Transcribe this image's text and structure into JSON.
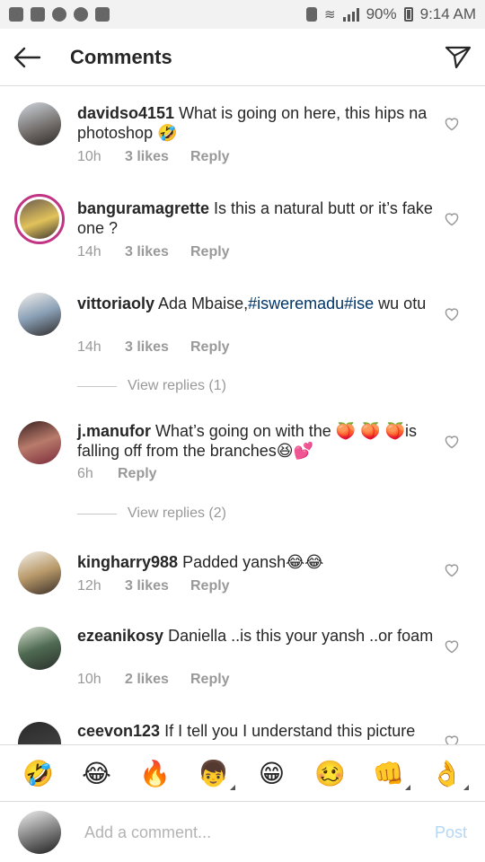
{
  "status_bar": {
    "battery": "90%",
    "time": "9:14 AM"
  },
  "header": {
    "title": "Comments"
  },
  "comments": [
    {
      "username": "davidso4151",
      "text": " What is going on here, this hips na photoshop 🤣",
      "time": "10h",
      "likes": "3 likes",
      "reply": "Reply"
    },
    {
      "username": "banguramagrette",
      "text": " Is this a natural butt or it’s fake one ?",
      "time": "14h",
      "likes": "3 likes",
      "reply": "Reply"
    },
    {
      "username": "vittoriaoly",
      "text_before": " Ada Mbaise,",
      "hashtag": "#isweremadu#ise",
      "text_after": " wu otu",
      "time": "14h",
      "likes": "3 likes",
      "reply": "Reply",
      "view_replies": "View replies (1)"
    },
    {
      "username": "j.manufor",
      "text": " What’s going on with the 🍑 🍑 🍑is falling off from the branches😆💕",
      "time": "6h",
      "reply": "Reply",
      "view_replies": "View replies (2)"
    },
    {
      "username": "kingharry988",
      "text": " Padded yansh😂😂",
      "time": "12h",
      "likes": "3 likes",
      "reply": "Reply"
    },
    {
      "username": "ezeanikosy",
      "text": " Daniella ..is this your yansh ..or foam",
      "time": "10h",
      "likes": "2 likes",
      "reply": "Reply"
    },
    {
      "username": "ceevon123",
      "text": " If I tell you I understand this picture"
    }
  ],
  "emoji_bar": [
    "🤣",
    "😂",
    "🔥",
    "👦",
    "😁",
    "🥴",
    "👊",
    "👌"
  ],
  "composer": {
    "placeholder": "Add a comment...",
    "post_label": "Post"
  },
  "colors": {
    "hashtag": "#003569",
    "post_disabled": "#b3d7f5",
    "ring": "#c13584"
  }
}
